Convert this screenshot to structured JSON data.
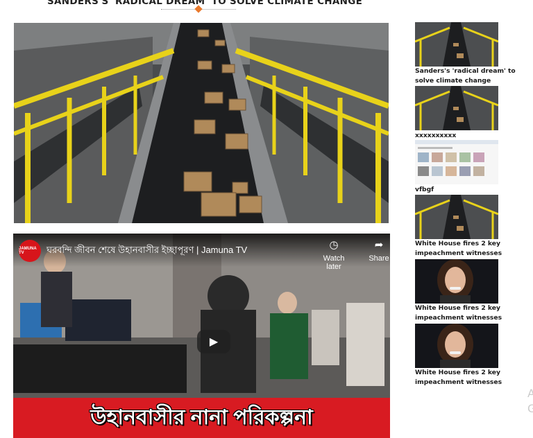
{
  "article": {
    "headline": "SANDERS'S 'RADICAL DREAM' TO SOLVE CLIMATE CHANGE",
    "main_image": "conveyor-belt-packages-photo"
  },
  "video": {
    "channel_logo": "JAMUNA TV",
    "title": "ঘরবন্দি জীবন শেষে উহানবাসীর ইচ্ছাপূরণ | Jamuna TV",
    "watch_later": "Watch later",
    "share": "Share",
    "caption": "উহানবাসীর নানা পরিকল্পনা",
    "icons": {
      "watch_later": "clock-icon",
      "share": "share-arrow-icon",
      "play": "play-icon"
    },
    "caption_color": "#d81b22"
  },
  "sidebar": {
    "items": [
      {
        "label": "Sanders's 'radical dream' to solve climate change",
        "thumb": "conveyor-belt"
      },
      {
        "label": "xxxxxxxxxx",
        "thumb": "conveyor-belt"
      },
      {
        "label": "vfbgf",
        "thumb": "webpage-screenshot"
      },
      {
        "label": "White House fires 2 key impeachment witnesses",
        "thumb": "conveyor-belt"
      },
      {
        "label": "White House fires 2 key impeachment witnesses",
        "thumb": "woman-portrait"
      },
      {
        "label": "White House fires 2 key impeachment witnesses",
        "thumb": "woman-portrait"
      }
    ]
  },
  "edge_text": {
    "line1": "A",
    "line2": "G"
  },
  "colors": {
    "accent": "#e9792c",
    "rail": "#e8d21a"
  }
}
